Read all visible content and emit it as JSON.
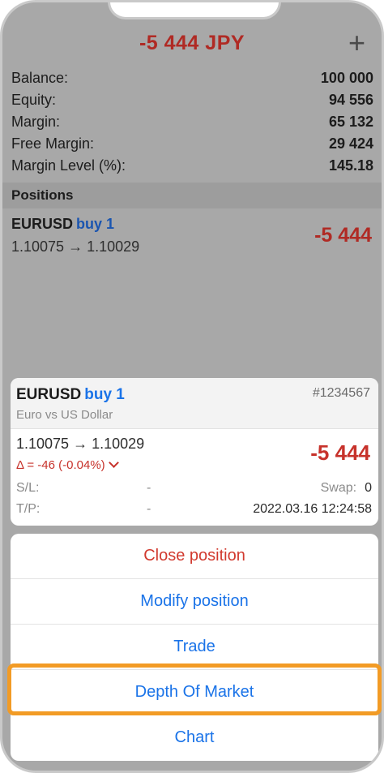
{
  "header": {
    "total": "-5 444 JPY",
    "add_label": "+"
  },
  "summary": [
    {
      "label": "Balance:",
      "value": "100 000"
    },
    {
      "label": "Equity:",
      "value": "94 556"
    },
    {
      "label": "Margin:",
      "value": "65 132"
    },
    {
      "label": "Free Margin:",
      "value": "29 424"
    },
    {
      "label": "Margin Level (%):",
      "value": "145.18"
    }
  ],
  "positions": {
    "title": "Positions",
    "item": {
      "symbol": "EURUSD",
      "direction": "buy 1",
      "prices": "1.10075 → 1.10029",
      "profit": "-5 444"
    }
  },
  "detail": {
    "symbol": "EURUSD",
    "direction": "buy 1",
    "ticket": "#1234567",
    "description": "Euro vs US Dollar",
    "prices": "1.10075 → 1.10029",
    "delta": "Δ = -46 (-0.04%)",
    "profit": "-5 444",
    "sl_label": "S/L:",
    "sl_value": "-",
    "swap_label": "Swap:",
    "swap_value": "0",
    "tp_label": "T/P:",
    "tp_value": "-",
    "time": "2022.03.16 12:24:58"
  },
  "actions": {
    "close": "Close position",
    "modify": "Modify position",
    "trade": "Trade",
    "depth": "Depth Of Market",
    "chart": "Chart"
  },
  "colors": {
    "accent": "#1a73e8",
    "loss": "#c7322b",
    "highlight": "#f29b25"
  }
}
